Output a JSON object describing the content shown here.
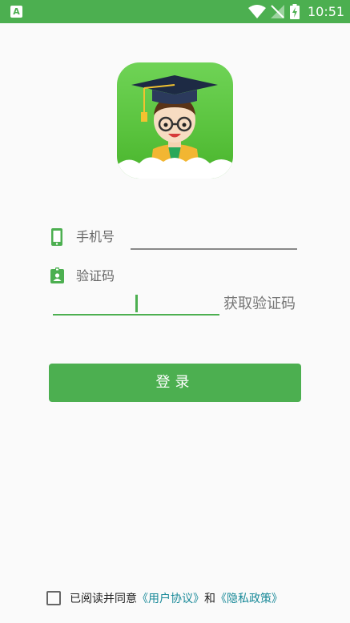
{
  "status_bar": {
    "app_icon_letter": "A",
    "time": "10:51",
    "icons": [
      "app-notification-icon",
      "wifi-icon",
      "no-signal-icon",
      "battery-charging-icon"
    ]
  },
  "logo": {
    "icon": "graduate-cartoon-icon"
  },
  "form": {
    "phone": {
      "icon": "phone-icon",
      "label": "手机号",
      "value": ""
    },
    "code": {
      "icon": "badge-icon",
      "label": "验证码",
      "value": ""
    },
    "get_code_label": "获取验证码"
  },
  "login_button": "登录",
  "agreement": {
    "checked": false,
    "text": "已阅读并同意",
    "user_agreement": "《用户协议》",
    "and": "和",
    "privacy_policy": "《隐私政策》"
  },
  "colors": {
    "primary": "#4caf50",
    "link": "#1a8a99",
    "background": "#fafafa"
  }
}
